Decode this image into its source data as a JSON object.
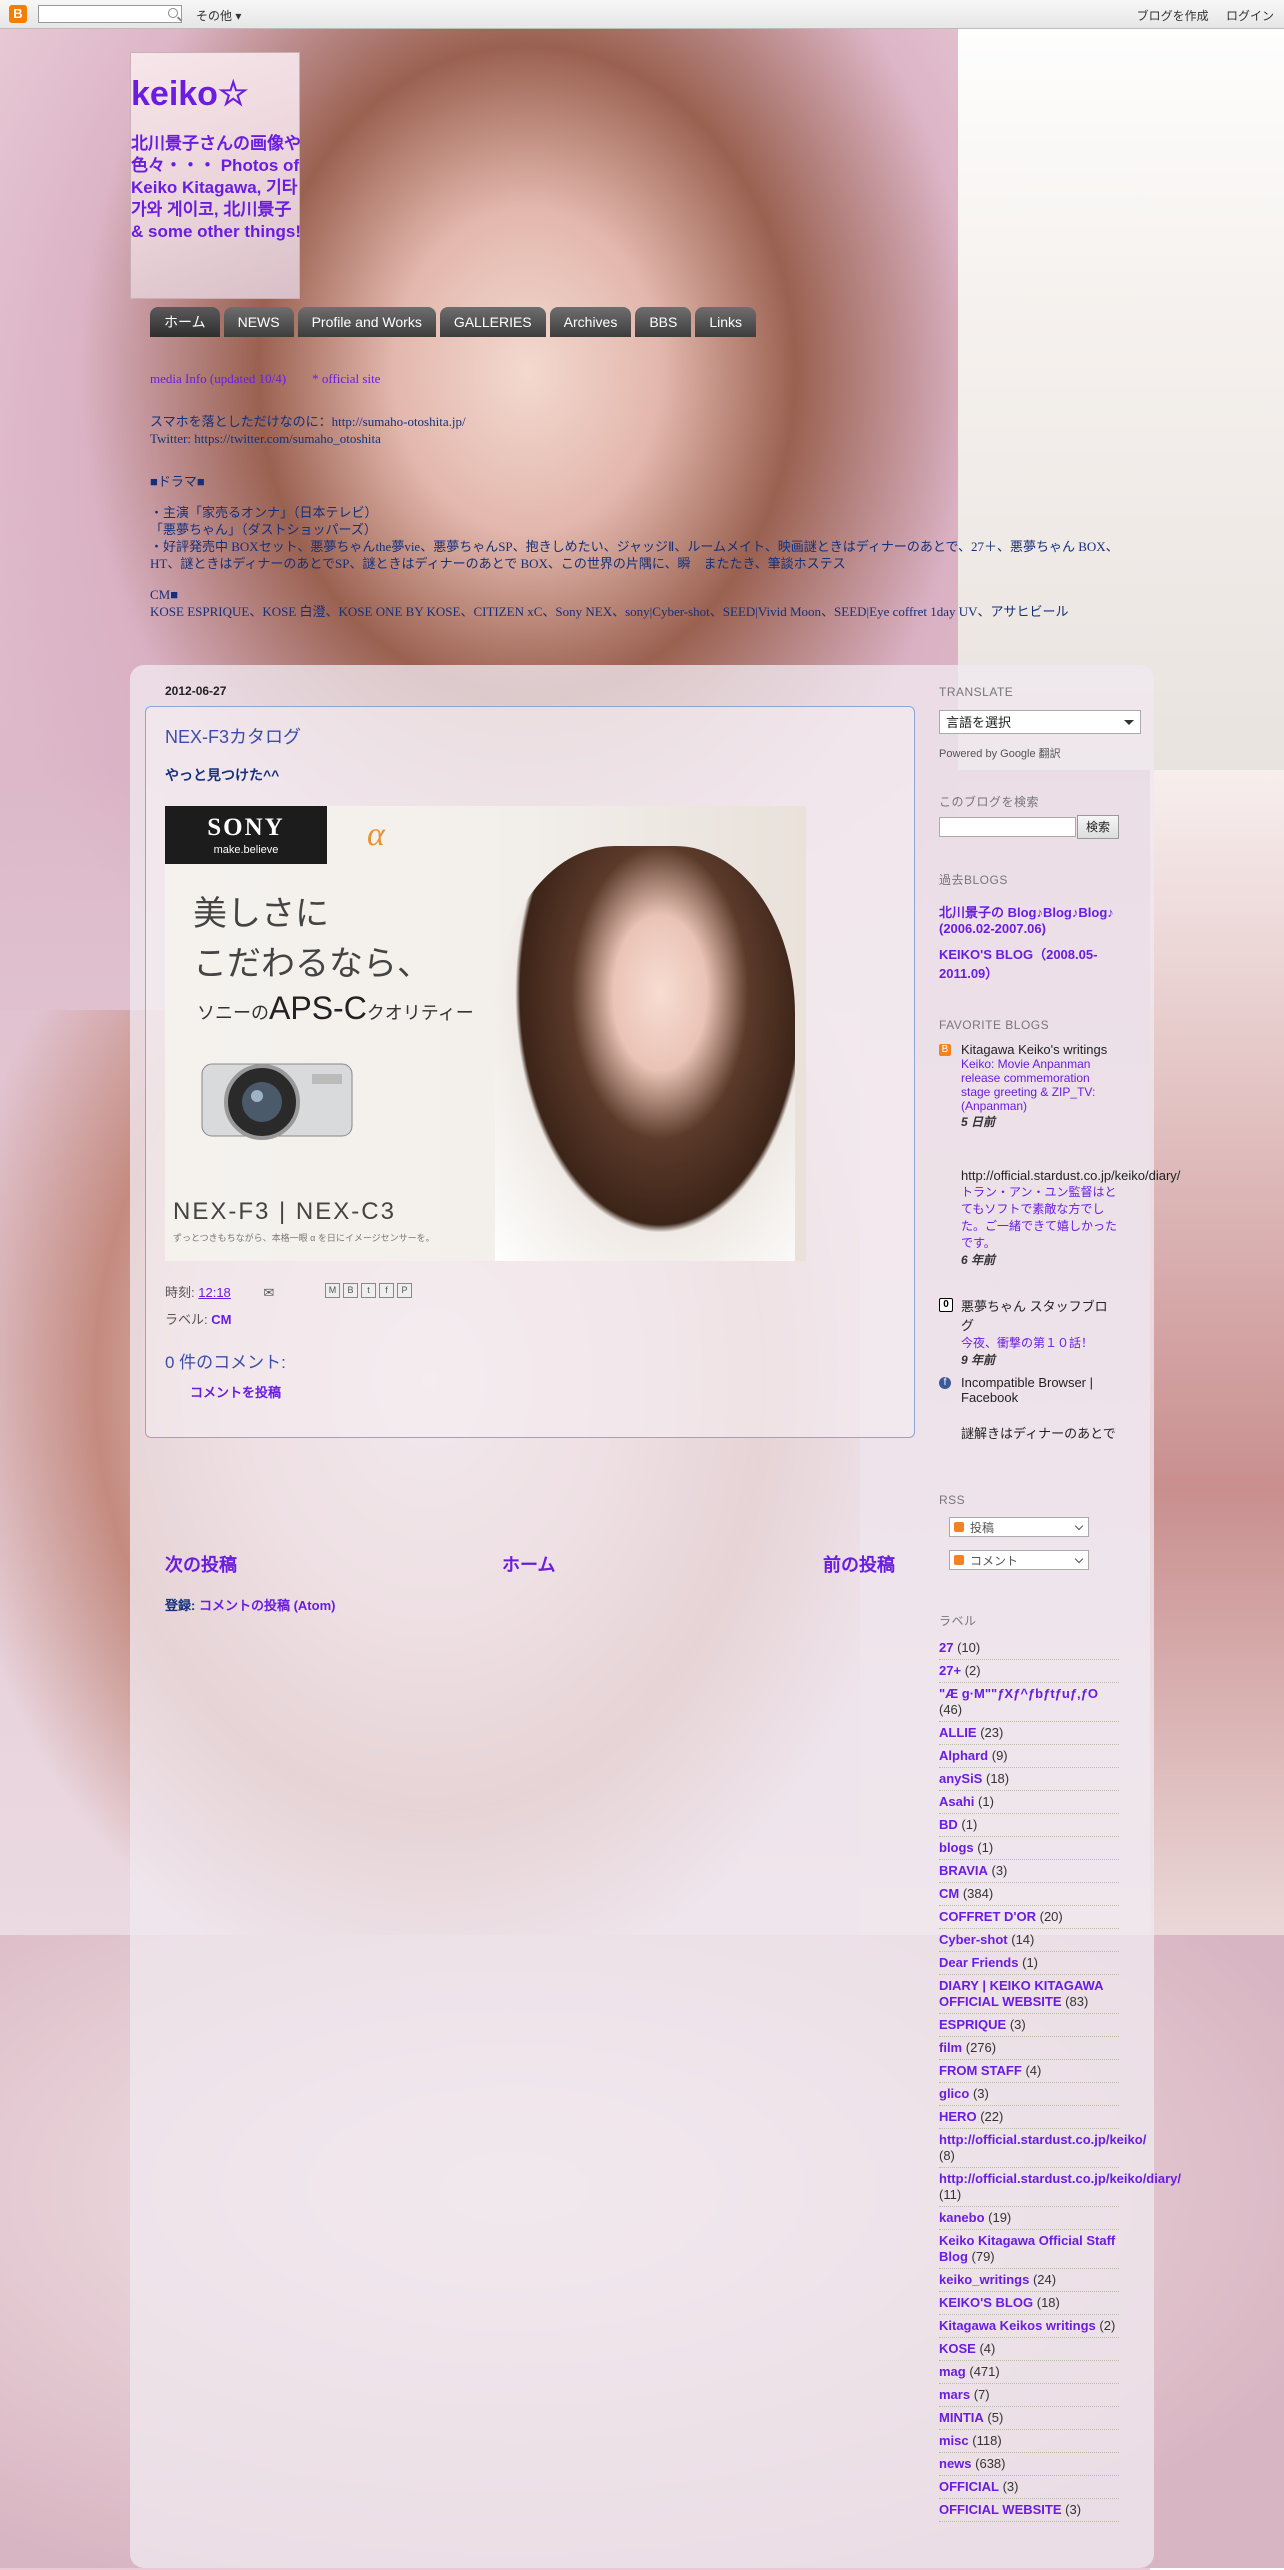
{
  "navbar": {
    "more": "その他 ▾",
    "create_blog": "ブログを作成",
    "login": "ログイン"
  },
  "header": {
    "title": "keiko☆",
    "description": "北川景子さんの画像や色々・・・ Photos of Keiko Kitagawa, 기타가와 게이코, 北川景子 & some other things!"
  },
  "tabs": [
    "ホーム",
    "NEWS",
    "Profile and Works",
    "GALLERIES",
    "Archives",
    "BBS",
    "Links"
  ],
  "info": {
    "line1_a": "media Info (updated 10/4)",
    "line1_b": "* official site",
    "line2": "スマホを落としただけなのに：http://sumaho-otoshita.jp/",
    "line3": "Twitter: https://twitter.com/sumaho_otoshita",
    "line4": "■ドラマ■",
    "line5": "・主演「家売るオンナ」（日本テレビ）",
    "line6": "「悪夢ちゃん」（ダストショッパーズ）",
    "line7": "・好評発売中 BOXセット、悪夢ちゃんthe夢vie、悪夢ちゃんSP、抱きしめたい、ジャッジⅡ、ルームメイト、映画謎ときはディナーのあとで、27＋、悪夢ちゃん BOX、HT、謎ときはディナーのあとでSP、謎ときはディナーのあとで BOX、この世界の片隅に、瞬　またたき、筆談ホステス",
    "line8": "CM■",
    "line9": "KOSE ESPRIQUE、KOSE 白澄、KOSE ONE BY KOSE、CITIZEN xC、Sony NEX、sony|Cyber-shot、SEED|Vivid Moon、SEED|Eye coffret 1day UV、アサヒビール"
  },
  "post": {
    "date": "2012-06-27",
    "title": "NEX-F3カタログ",
    "body": "やっと見つけた^^",
    "posted_at_label": "時刻:",
    "posted_at": "12:18",
    "labels_label": "ラベル:",
    "label": "CM",
    "comments_title": "0 件のコメント:",
    "post_comment": "コメントを投稿"
  },
  "ad": {
    "brand": "SONY",
    "tagline": "make.believe",
    "alpha": "α",
    "copy1": "美しさに",
    "copy2": "こだわるなら、",
    "copy3_pre": "ソニーの",
    "copy3_big": "APS-C",
    "copy3_post": "クオリティー",
    "model": "NEX-F3 | NEX-C3",
    "sub": "ずっとつきもちながら、本格一眼 α を日にイメージセンサーを。"
  },
  "pager": {
    "newer": "次の投稿",
    "home": "ホーム",
    "older": "前の投稿",
    "subscribe_label": "登録:",
    "subscribe_link": "コメントの投稿 (Atom)"
  },
  "sidebar": {
    "translate_title": "TRANSLATE",
    "lang_select": "言語を選択",
    "powered": "Powered by Google 翻訳",
    "search_title": "このブログを検索",
    "search_button": "検索",
    "past_title": "過去BLOGS",
    "past_1": "北川景子の Blog♪Blog♪Blog♪ (2006.02-2007.06)",
    "past_2": "KEIKO'S BLOG（2008.05-2011.09）",
    "fav_title": "FAVORITE BLOGS",
    "fav": [
      {
        "name": "Kitagawa Keiko's writings",
        "snippet": "Keiko: Movie Anpanman release commemoration stage greeting & ZIP_TV: (Anpanman)",
        "time": "5 日前"
      },
      {
        "name": "http://official.stardust.co.jp/keiko/diary/",
        "snippet": "トラン・アン・ユン監督はとてもソフトで素敵な方でした。ご一緒できて嬉しかったです。",
        "time": "6 年前"
      },
      {
        "name": "悪夢ちゃん スタッフブログ",
        "snippet": "今夜、衝撃の第１０話！",
        "time": "9 年前"
      },
      {
        "name": "Incompatible Browser | Facebook",
        "snippet": "",
        "time": ""
      },
      {
        "name": "謎解きはディナーのあとで",
        "snippet": "",
        "time": ""
      }
    ],
    "rss_title": "RSS",
    "rss_posts": "投稿",
    "rss_comments": "コメント",
    "labels_title": "ラベル",
    "labels": [
      {
        "name": "27",
        "count": "(10)"
      },
      {
        "name": "27+",
        "count": "(2)"
      },
      {
        "name": "\"Æ g·M\"\"ƒXƒ^ƒbƒtƒuƒ‚ƒO",
        "count": "(46)"
      },
      {
        "name": "ALLIE",
        "count": "(23)"
      },
      {
        "name": "Alphard",
        "count": "(9)"
      },
      {
        "name": "anySiS",
        "count": "(18)"
      },
      {
        "name": "Asahi",
        "count": "(1)"
      },
      {
        "name": "BD",
        "count": "(1)"
      },
      {
        "name": "blogs",
        "count": "(1)"
      },
      {
        "name": "BRAVIA",
        "count": "(3)"
      },
      {
        "name": "CM",
        "count": "(384)"
      },
      {
        "name": "COFFRET D'OR",
        "count": "(20)"
      },
      {
        "name": "Cyber-shot",
        "count": "(14)"
      },
      {
        "name": "Dear Friends",
        "count": "(1)"
      },
      {
        "name": "DIARY | KEIKO KITAGAWA OFFICIAL WEBSITE",
        "count": "(83)"
      },
      {
        "name": "ESPRIQUE",
        "count": "(3)"
      },
      {
        "name": "film",
        "count": "(276)"
      },
      {
        "name": "FROM STAFF",
        "count": "(4)"
      },
      {
        "name": "glico",
        "count": "(3)"
      },
      {
        "name": "HERO",
        "count": "(22)"
      },
      {
        "name": "http://official.stardust.co.jp/keiko/",
        "count": "(8)"
      },
      {
        "name": "http://official.stardust.co.jp/keiko/diary/",
        "count": "(11)"
      },
      {
        "name": "kanebo",
        "count": "(19)"
      },
      {
        "name": "Keiko Kitagawa Official Staff Blog",
        "count": "(79)"
      },
      {
        "name": "keiko_writings",
        "count": "(24)"
      },
      {
        "name": "KEIKO'S BLOG",
        "count": "(18)"
      },
      {
        "name": "Kitagawa Keikos writings",
        "count": "(2)"
      },
      {
        "name": "KOSE",
        "count": "(4)"
      },
      {
        "name": "mag",
        "count": "(471)"
      },
      {
        "name": "mars",
        "count": "(7)"
      },
      {
        "name": "MINTIA",
        "count": "(5)"
      },
      {
        "name": "misc",
        "count": "(118)"
      },
      {
        "name": "news",
        "count": "(638)"
      },
      {
        "name": "OFFICIAL",
        "count": "(3)"
      },
      {
        "name": "OFFICIAL WEBSITE",
        "count": "(3)"
      }
    ]
  }
}
